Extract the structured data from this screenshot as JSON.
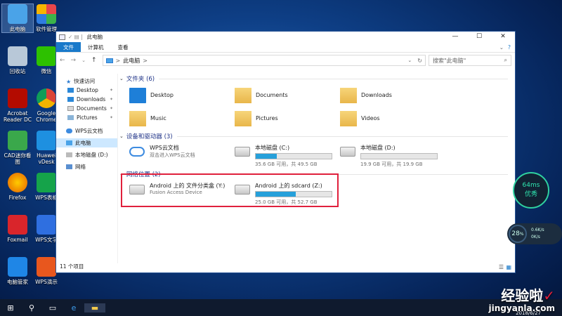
{
  "desktop": {
    "icons": [
      {
        "label": "此电脑"
      },
      {
        "label": "软件管理"
      },
      {
        "label": "回收站"
      },
      {
        "label": "微信"
      },
      {
        "label": "Acrobat Reader DC"
      },
      {
        "label": "Google Chrome"
      },
      {
        "label": "CAD迷你看图"
      },
      {
        "label": "Huawei vDesk"
      },
      {
        "label": "Firefox"
      },
      {
        "label": "WPS表格"
      },
      {
        "label": "Foxmail"
      },
      {
        "label": "WPS文字"
      },
      {
        "label": "电脑管家"
      },
      {
        "label": "WPS演示"
      }
    ]
  },
  "window": {
    "title": "此电脑",
    "ribbon": {
      "file": "文件",
      "computer": "计算机",
      "view": "查看",
      "help": "?"
    },
    "address": {
      "path": "此电脑",
      "sep": ">",
      "search_placeholder": "搜索\"此电脑\""
    },
    "nav": [
      {
        "label": "快速访问"
      },
      {
        "label": "Desktop"
      },
      {
        "label": "Downloads"
      },
      {
        "label": "Documents"
      },
      {
        "label": "Pictures"
      },
      {
        "label": "WPS云文档"
      },
      {
        "label": "此电脑"
      },
      {
        "label": "本地磁盘 (D:)"
      },
      {
        "label": "网络"
      }
    ],
    "groups": {
      "folders": {
        "title": "文件夹 (6)",
        "items": [
          {
            "name": "Desktop"
          },
          {
            "name": "Documents"
          },
          {
            "name": "Downloads"
          },
          {
            "name": "Music"
          },
          {
            "name": "Pictures"
          },
          {
            "name": "Videos"
          }
        ]
      },
      "drives": {
        "title": "设备和驱动器 (3)",
        "items": [
          {
            "name": "WPS云文档",
            "sub": "双击进入WPS云文档",
            "fill": null
          },
          {
            "name": "本地磁盘 (C:)",
            "sub": "35.6 GB 可用，共 49.5 GB",
            "fill": 0.28
          },
          {
            "name": "本地磁盘 (D:)",
            "sub": "19.9 GB 可用，共 19.9 GB",
            "fill": 0.0
          }
        ]
      },
      "network": {
        "title": "网络位置 (2)",
        "items": [
          {
            "name": "Android 上的 文件分类盒 (Y:)",
            "sub": "Fusion Access Device",
            "fill": null
          },
          {
            "name": "Android 上的 sdcard (Z:)",
            "sub": "25.0 GB 可用，共 52.7 GB",
            "fill": 0.53
          }
        ]
      }
    },
    "status": "11 个项目"
  },
  "widgets": {
    "ping": "64ms",
    "quality": "优秀",
    "cpu": "28",
    "unit": "%",
    "up": "0.6K/s",
    "down": "0K/s"
  },
  "taskbar": {
    "date": "2018/6/27"
  },
  "watermark": {
    "cn": "经验啦",
    "url": "jingyanla.com"
  },
  "colors": {
    "accent": "#1979ca",
    "highlight": "#e0203c",
    "bar": "#26a0da"
  }
}
